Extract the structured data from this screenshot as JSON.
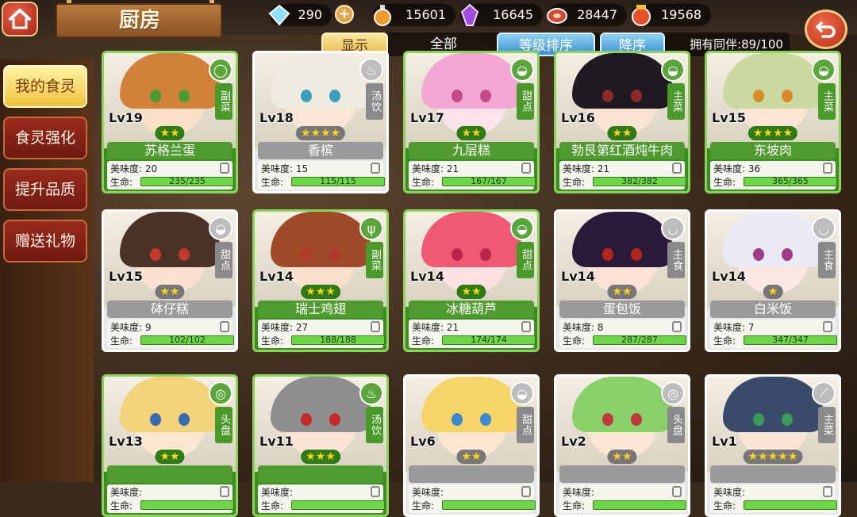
{
  "title": "厨房",
  "resources": {
    "gems": "290",
    "potion": "15601",
    "crystal": "16645",
    "meat": "28447",
    "spice": "19568"
  },
  "filters": {
    "show": "显示",
    "all": "全部",
    "level_sort": "等级排序",
    "descending": "降序",
    "count": "拥有同伴:89/100"
  },
  "side_menu": [
    "我的食灵",
    "食灵强化",
    "提升品质",
    "赠送礼物"
  ],
  "labels": {
    "taste": "美味度:",
    "hp": "生命:"
  },
  "cards": [
    {
      "level": "Lv19",
      "stars": "★★",
      "name": "苏格兰蛋",
      "tag": "副菜",
      "taste": "20",
      "hp": "235/235",
      "tier": "green",
      "badge_icon": "plate-icon",
      "colors": {
        "hair": "#d2813a",
        "face": "#fbe0c8",
        "eye": "#4a9a36"
      }
    },
    {
      "level": "Lv18",
      "stars": "★★★★",
      "name": "香槟",
      "tag": "汤饮",
      "taste": "15",
      "hp": "115/115",
      "tier": "white",
      "badge_icon": "soup-icon",
      "colors": {
        "hair": "#f0ebe0",
        "face": "#fbe6d6",
        "eye": "#3c9fb8"
      }
    },
    {
      "level": "Lv17",
      "stars": "★★",
      "name": "九层糕",
      "tag": "甜点",
      "taste": "21",
      "hp": "167/167",
      "tier": "green",
      "badge_icon": "cake-icon",
      "colors": {
        "hair": "#f2a8d2",
        "face": "#fde4ec",
        "eye": "#c44a8a"
      }
    },
    {
      "level": "Lv16",
      "stars": "★★",
      "name": "勃艮第红酒炖牛肉",
      "tag": "主菜",
      "taste": "21",
      "hp": "382/382",
      "tier": "green",
      "badge_icon": "meat-icon",
      "colors": {
        "hair": "#1f1a22",
        "face": "#fbe3d4",
        "eye": "#8a2a2a"
      }
    },
    {
      "level": "Lv15",
      "stars": "★★★★",
      "name": "东坡肉",
      "tag": "主菜",
      "taste": "36",
      "hp": "365/365",
      "tier": "green",
      "badge_icon": "meat-icon",
      "colors": {
        "hair": "#c9d9a0",
        "face": "#fbe6d4",
        "eye": "#d68a2a"
      }
    },
    {
      "level": "Lv15",
      "stars": "★★",
      "name": "砵仔糕",
      "tag": "甜点",
      "taste": "9",
      "hp": "102/102",
      "tier": "white",
      "badge_icon": "cake-icon",
      "colors": {
        "hair": "#4a3326",
        "face": "#fbe1d0",
        "eye": "#c43a2a"
      }
    },
    {
      "level": "Lv14",
      "stars": "★★★",
      "name": "瑞士鸡翅",
      "tag": "副菜",
      "taste": "27",
      "hp": "188/188",
      "tier": "green",
      "badge_icon": "fork-icon",
      "colors": {
        "hair": "#a14a2a",
        "face": "#fbe0cc",
        "eye": "#b03a2a"
      }
    },
    {
      "level": "Lv14",
      "stars": "★★",
      "name": "冰糖葫芦",
      "tag": "甜点",
      "taste": "21",
      "hp": "174/174",
      "tier": "green",
      "badge_icon": "cake-icon",
      "colors": {
        "hair": "#ef5a72",
        "face": "#fde0e0",
        "eye": "#b8264a"
      }
    },
    {
      "level": "Lv14",
      "stars": "★★",
      "name": "蛋包饭",
      "tag": "主食",
      "taste": "8",
      "hp": "287/287",
      "tier": "white",
      "badge_icon": "rice-bowl-icon",
      "colors": {
        "hair": "#2c1a3a",
        "face": "#fbe2d4",
        "eye": "#b3261e"
      }
    },
    {
      "level": "Lv14",
      "stars": "★",
      "name": "白米饭",
      "tag": "主食",
      "taste": "7",
      "hp": "347/347",
      "tier": "white",
      "badge_icon": "rice-bowl-icon",
      "colors": {
        "hair": "#eaeaf6",
        "face": "#fde8e4",
        "eye": "#a03a8a"
      }
    },
    {
      "level": "Lv13",
      "stars": "★★",
      "name": "",
      "tag": "头盘",
      "taste": "",
      "hp": "",
      "tier": "green",
      "badge_icon": "platter-icon",
      "colors": {
        "hair": "#f2d27a",
        "face": "#fbe6d0",
        "eye": "#3a6ab0"
      }
    },
    {
      "level": "Lv11",
      "stars": "★★★",
      "name": "",
      "tag": "汤饮",
      "taste": "",
      "hp": "",
      "tier": "green",
      "badge_icon": "soup-icon",
      "colors": {
        "hair": "#8e8e8e",
        "face": "#fbe4d6",
        "eye": "#c42a2a"
      }
    },
    {
      "level": "Lv6",
      "stars": "★★",
      "name": "",
      "tag": "甜点",
      "taste": "",
      "hp": "",
      "tier": "white",
      "badge_icon": "cake-icon",
      "colors": {
        "hair": "#f6d46a",
        "face": "#fde6d0",
        "eye": "#3a8ad0"
      }
    },
    {
      "level": "Lv2",
      "stars": "★★",
      "name": "",
      "tag": "头盘",
      "taste": "",
      "hp": "",
      "tier": "white",
      "badge_icon": "platter-icon",
      "colors": {
        "hair": "#8ad06a",
        "face": "#fbe6d4",
        "eye": "#c03a3a"
      }
    },
    {
      "level": "Lv1",
      "stars": "★★★★★",
      "name": "",
      "tag": "主菜",
      "taste": "",
      "hp": "",
      "tier": "white",
      "badge_icon": "knife-icon",
      "colors": {
        "hair": "#3a4a6a",
        "face": "#fbe4d4",
        "eye": "#3a9a5a"
      }
    }
  ]
}
